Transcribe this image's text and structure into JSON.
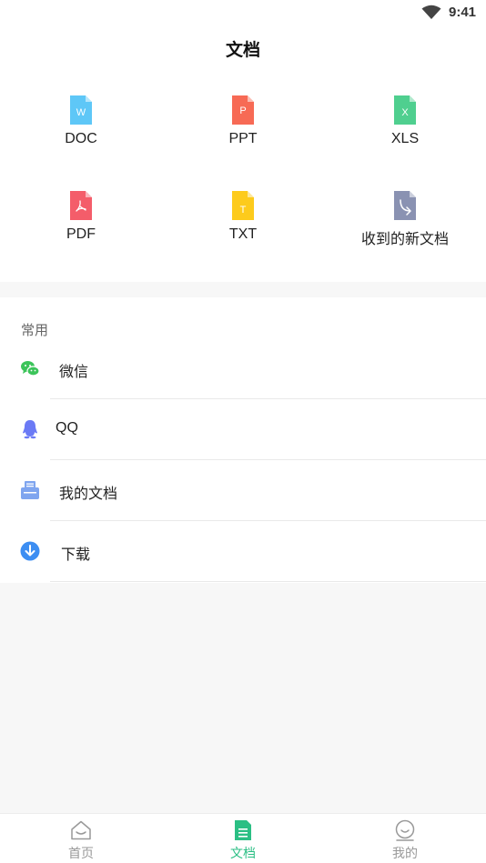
{
  "status_bar": {
    "time": "9:41"
  },
  "page_title": "文档",
  "file_types": [
    {
      "label": "DOC",
      "badge": "W",
      "color": "#5ec7f7"
    },
    {
      "label": "PPT",
      "badge": "P",
      "color": "#f76a55"
    },
    {
      "label": "XLS",
      "badge": "X",
      "color": "#4fcf8f"
    },
    {
      "label": "PDF",
      "badge": "",
      "color": "#f45d6a"
    },
    {
      "label": "TXT",
      "badge": "T",
      "color": "#fdcb1c"
    },
    {
      "label": "收到的新文档",
      "badge": "",
      "color": "#8a92b2"
    }
  ],
  "common": {
    "title": "常用",
    "items": [
      {
        "label": "微信",
        "icon": "wechat-icon",
        "color": "#3cc45a"
      },
      {
        "label": "QQ",
        "icon": "qq-icon",
        "color": "#6b7af5"
      },
      {
        "label": "我的文档",
        "icon": "folder-icon",
        "color": "#7fa5ef"
      },
      {
        "label": "下载",
        "icon": "download-icon",
        "color": "#3d8ef2"
      }
    ]
  },
  "tabbar": {
    "tabs": [
      {
        "label": "首页",
        "icon": "home-icon",
        "active": false
      },
      {
        "label": "文档",
        "icon": "document-icon",
        "active": true
      },
      {
        "label": "我的",
        "icon": "profile-icon",
        "active": false
      }
    ],
    "active_color": "#2bbf84",
    "inactive_color": "#999999"
  }
}
